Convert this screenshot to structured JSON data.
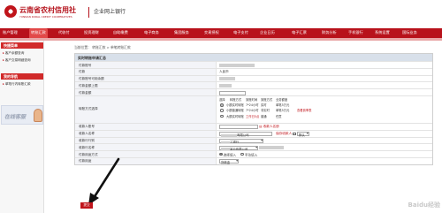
{
  "header": {
    "brand": "云南省农村信用社",
    "brand_en": "YUNNAN RURAL CREDIT COOPERATIVES",
    "section": "企业网上银行"
  },
  "nav": [
    {
      "label": "账户管理",
      "active": false
    },
    {
      "label": "转账汇款",
      "active": true
    },
    {
      "label": "代收付",
      "active": false
    },
    {
      "label": "投资理财",
      "active": false
    },
    {
      "label": "自助缴费",
      "active": false
    },
    {
      "label": "电子商务",
      "active": false
    },
    {
      "label": "集团服务",
      "active": false
    },
    {
      "label": "交易授权",
      "active": false
    },
    {
      "label": "电子支付",
      "active": false
    },
    {
      "label": "企业日历",
      "active": false
    },
    {
      "label": "电子汇票",
      "active": false
    },
    {
      "label": "财务分析",
      "active": false
    },
    {
      "label": "手机银行",
      "active": false
    },
    {
      "label": "系统设置",
      "active": false
    },
    {
      "label": "国际业务",
      "active": false
    }
  ],
  "sidebar": {
    "sections": [
      {
        "title": "快捷菜单",
        "items": [
          "客户余额查询",
          "客户交易明细查询"
        ]
      },
      {
        "title": "我的导航",
        "items": [
          "单笔行内转账汇款"
        ]
      }
    ],
    "service_label": "在线客服"
  },
  "breadcrumb": "当前位置： 转账汇款 > 单笔转账汇款",
  "form": {
    "title": "实时转账申请汇总",
    "rows": {
      "payer_account": {
        "label": "付款账号"
      },
      "payer_name": {
        "label": "付款",
        "value": "人民币"
      },
      "payer_balance": {
        "label": "付款账号可用余额"
      },
      "amount_cap": {
        "label": "付款金额上限"
      },
      "amount": {
        "label": "付款金额"
      },
      "method": {
        "label": "转账方式选择",
        "headers": [
          "选择",
          "转账方式",
          "到账时间",
          "到账方式",
          "业务额度"
        ],
        "options": [
          {
            "selected": true,
            "method": "小额实时转账",
            "time": "7*24小时",
            "mode": "实时",
            "limit": "单笔5万元"
          },
          {
            "selected": false,
            "method": "小额普通转账",
            "time": "7*24小时",
            "mode": "非实时",
            "limit": "单笔5万元"
          },
          {
            "selected": false,
            "method": "大额实时转账",
            "time": "工作日5点",
            "mode": "普通",
            "limit": "任意"
          }
        ],
        "note": "查看费率表"
      },
      "payee_account": {
        "label": "收款人账号",
        "link": "收款人名册"
      },
      "payee_name": {
        "label": "收款人名称",
        "value": "有限公司",
        "link": "保存收款人",
        "check_label": "默认"
      },
      "payee_bank": {
        "label": "收款行行别",
        "value": "工银行"
      },
      "payee_branch": {
        "label": "收款行名称",
        "value": "某分有限公司"
      },
      "usage": {
        "label": "付款用途方式",
        "options": [
          "选择填入",
          "手动填入"
        ]
      },
      "purpose": {
        "label": "付款用途",
        "value": "货款金"
      }
    }
  },
  "submit_label": "提交",
  "watermark": "Baidu经验"
}
